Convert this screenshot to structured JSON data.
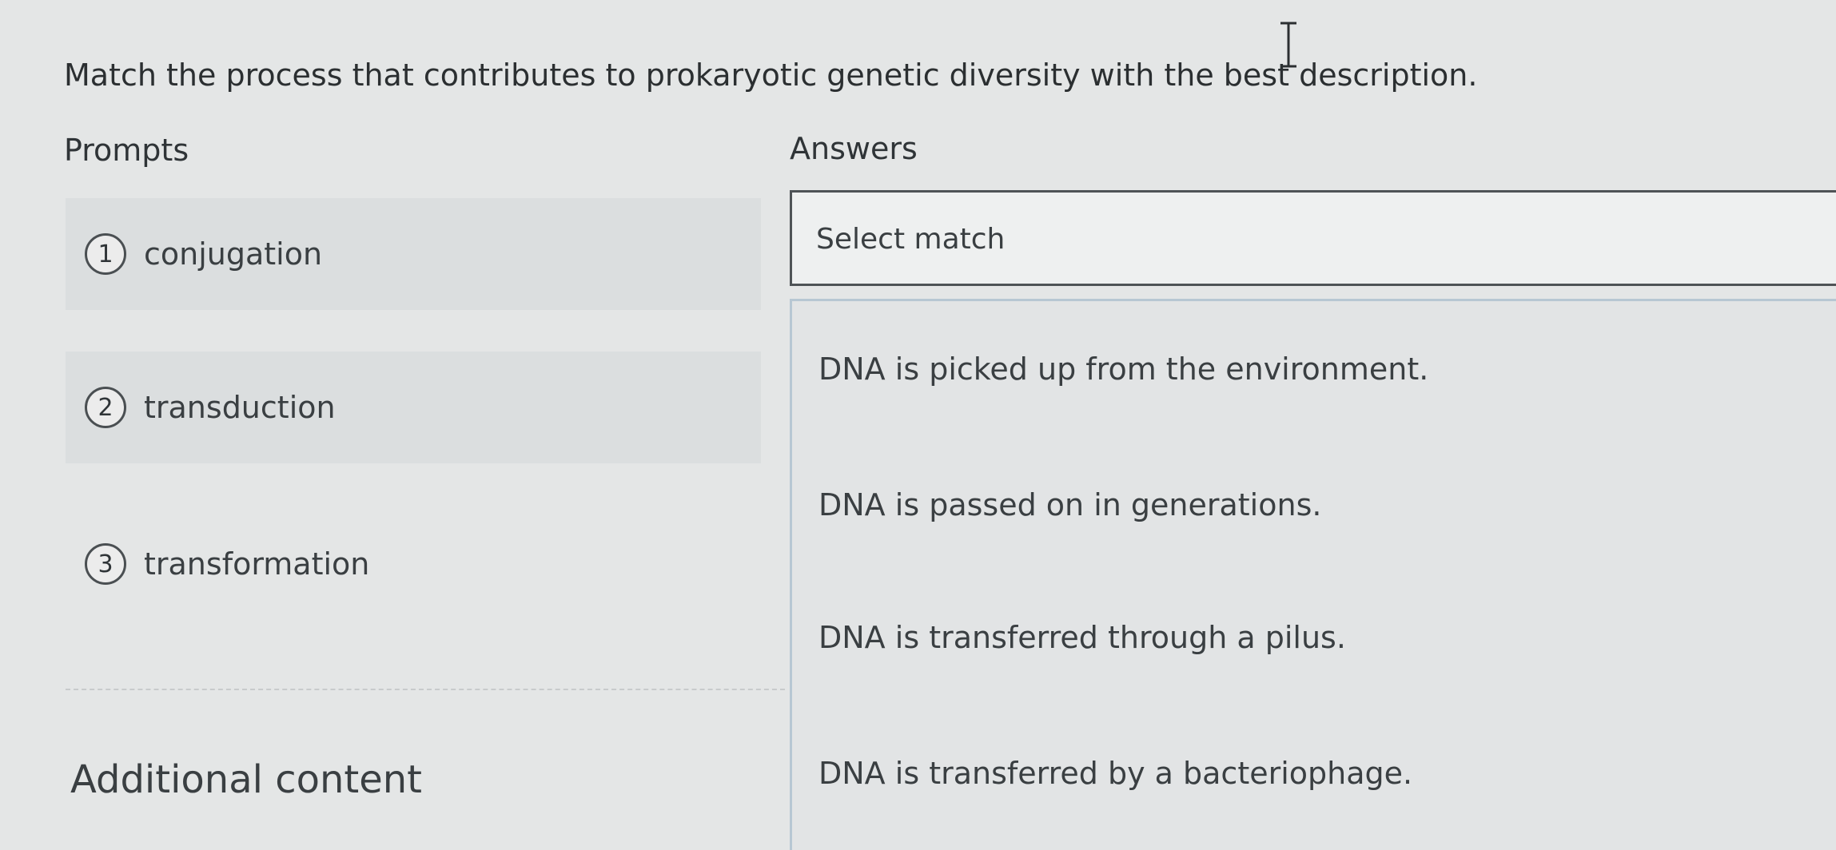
{
  "question": "Match the process that contributes to prokaryotic genetic diversity with the best description.",
  "prompts_header": "Prompts",
  "answers_header": "Answers",
  "prompts": [
    {
      "number": "1",
      "label": "conjugation"
    },
    {
      "number": "2",
      "label": "transduction"
    },
    {
      "number": "3",
      "label": "transformation"
    }
  ],
  "drop_zone": {
    "label": "Select match"
  },
  "answers": [
    "DNA is picked up from the environment.",
    "DNA is passed on in generations.",
    "DNA is transferred through a pilus.",
    "DNA is transferred by a bacteriophage."
  ],
  "additional_content": "Additional content",
  "icons": {
    "cursor": "text-cursor-icon"
  }
}
